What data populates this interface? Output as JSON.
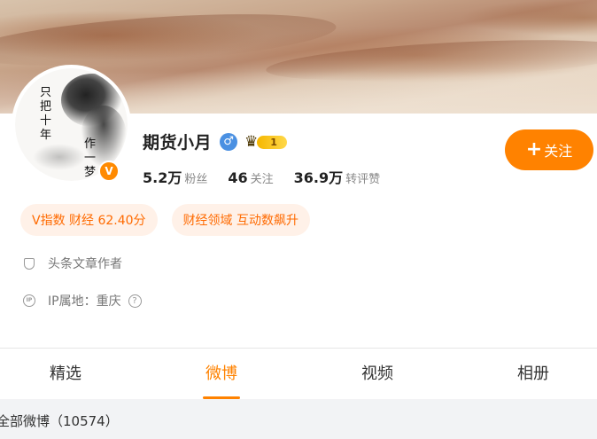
{
  "profile": {
    "name": "期货小月",
    "level": "1",
    "avatar_text_1": "只把十年",
    "avatar_text_2": "作一梦",
    "verified_badge": "V"
  },
  "stats": [
    {
      "num": "5.2万",
      "label": "粉丝"
    },
    {
      "num": "46",
      "label": "关注"
    },
    {
      "num": "36.9万",
      "label": "转评赞"
    }
  ],
  "follow_button": {
    "plus": "+",
    "label": "关注"
  },
  "tags": [
    "V指数 财经 62.40分",
    "财经领域 互动数飙升"
  ],
  "info": {
    "role": "头条文章作者",
    "ip_icon_text": "IP",
    "ip_location": "IP属地：重庆",
    "help": "?"
  },
  "tabs": [
    {
      "label": "精选",
      "active": false
    },
    {
      "label": "微博",
      "active": true
    },
    {
      "label": "视频",
      "active": false
    },
    {
      "label": "相册",
      "active": false
    }
  ],
  "feed": {
    "header": "全部微博（10574）"
  },
  "colors": {
    "accent": "#ff8200",
    "tag_bg": "#fff1e8",
    "tag_text": "#ff6a00",
    "gender_blue": "#4a90e2"
  }
}
